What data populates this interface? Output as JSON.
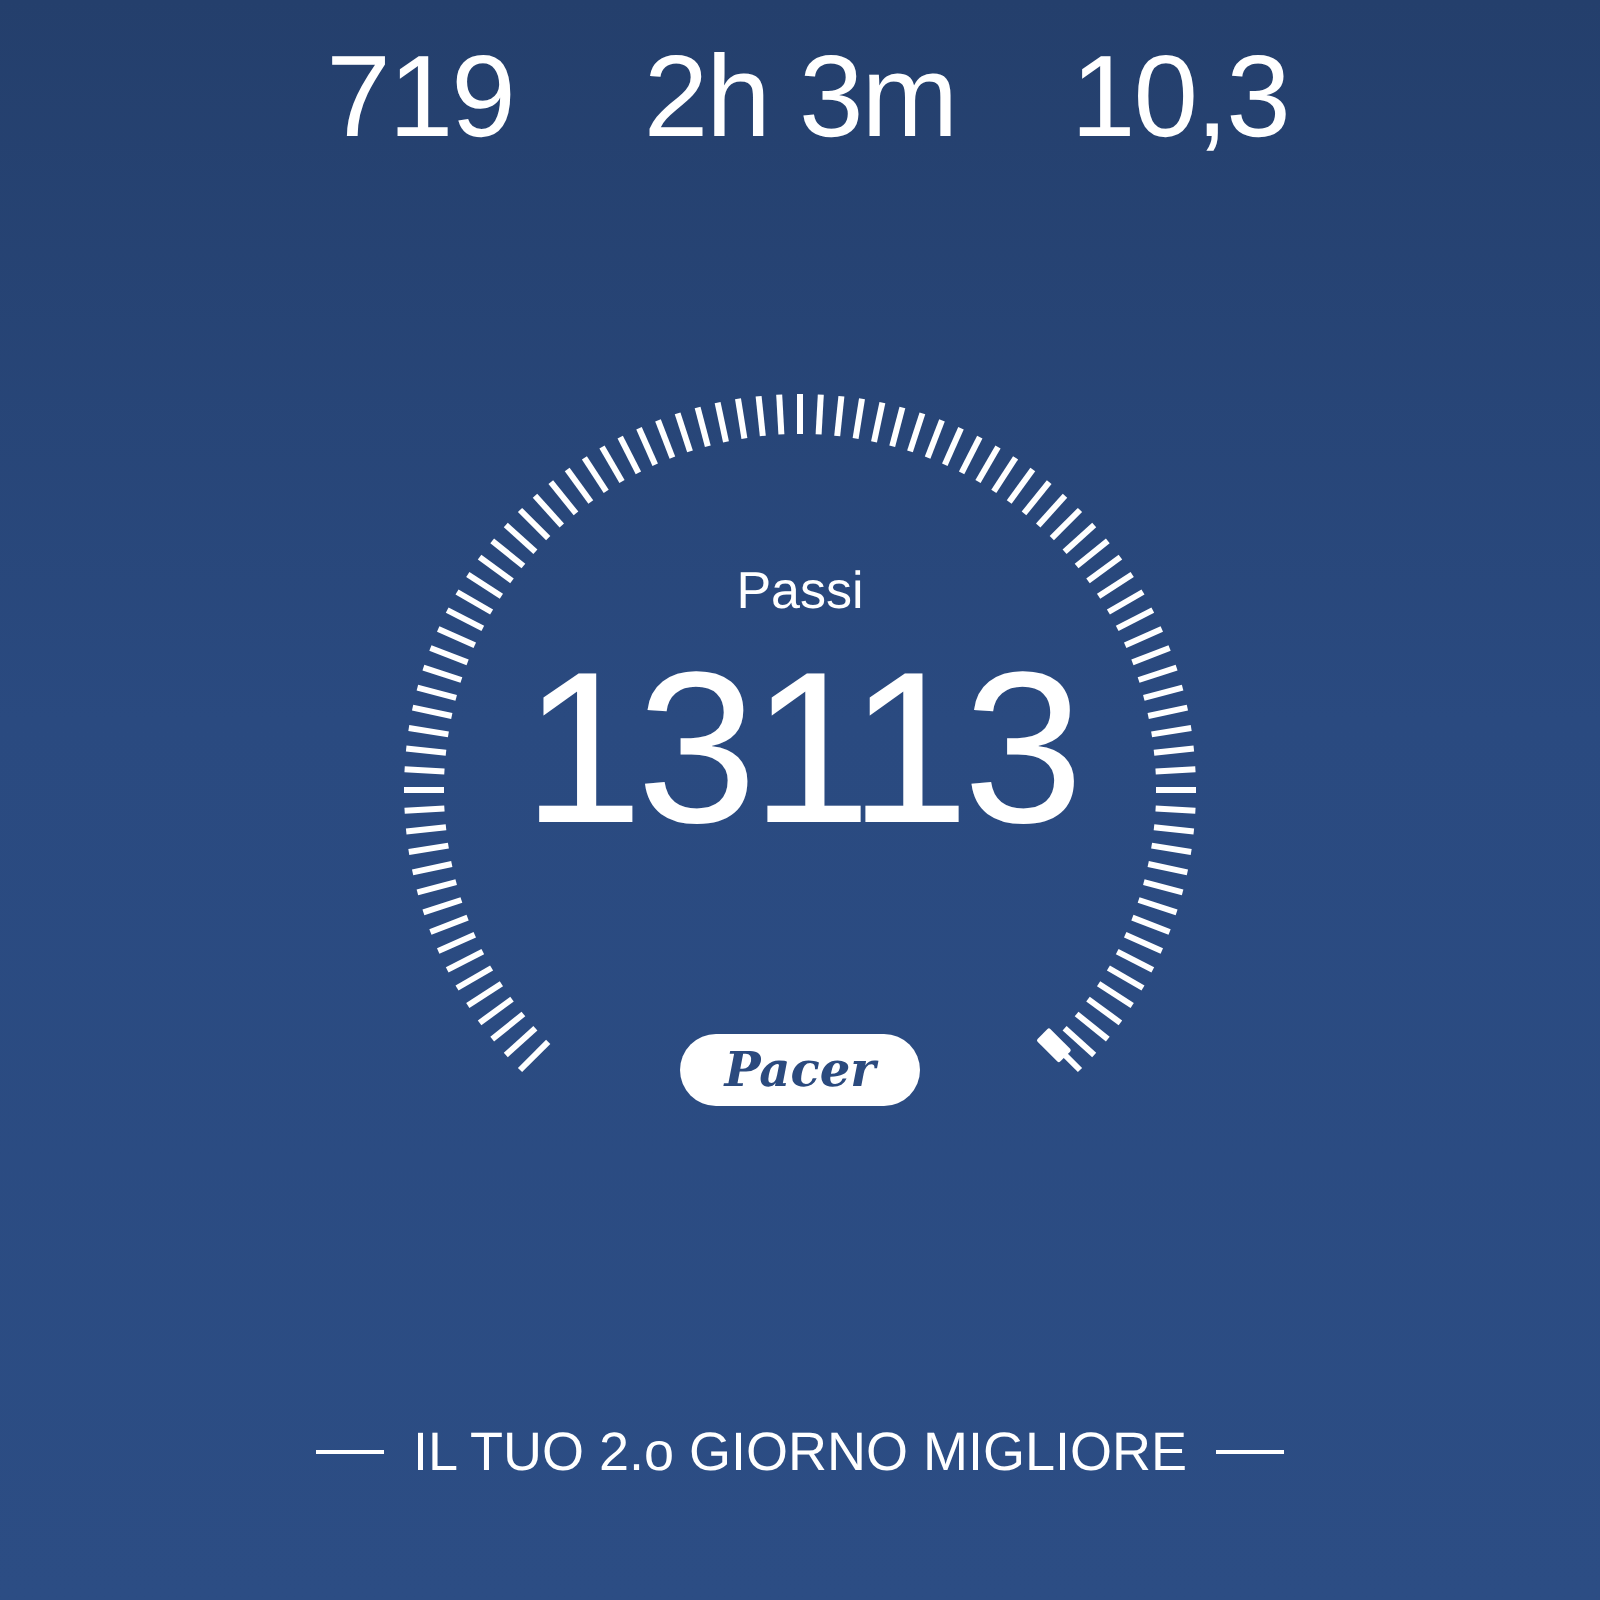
{
  "stats": [
    {
      "value": "719"
    },
    {
      "value": "2h 3m"
    },
    {
      "value": "10,3"
    }
  ],
  "gauge": {
    "label": "Passi",
    "value": "13113",
    "brand": "Pacer"
  },
  "achievement": "IL TUO 2.o GIORNO MIGLIORE"
}
